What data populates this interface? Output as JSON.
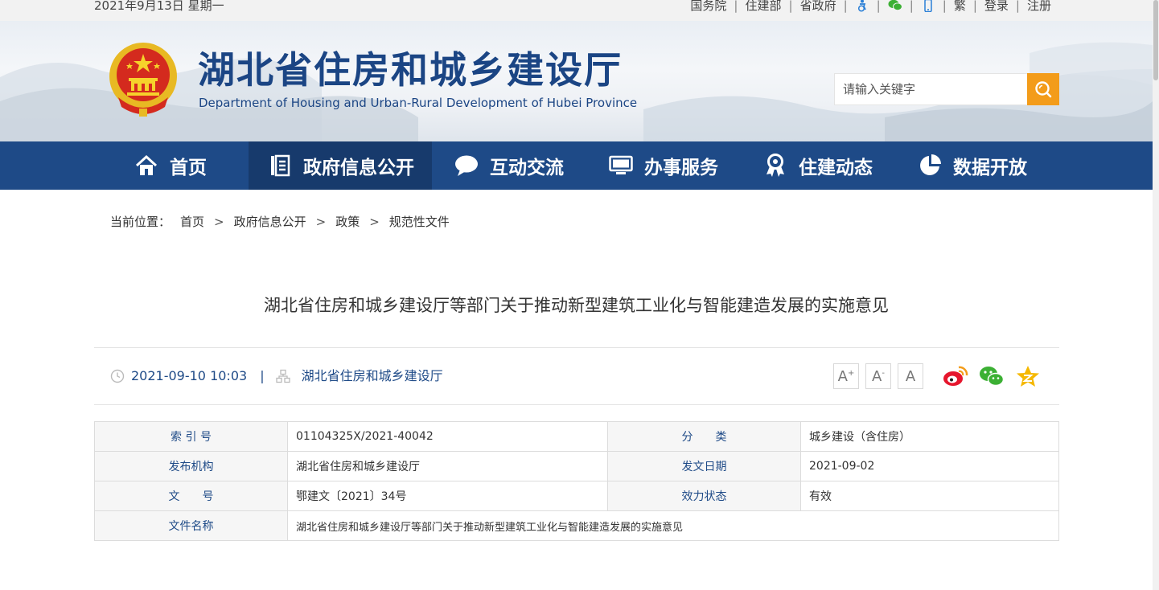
{
  "topbar": {
    "date": "2021年9月13日 星期一",
    "links": [
      {
        "label": "国务院"
      },
      {
        "label": "住建部"
      },
      {
        "label": "省政府"
      },
      {
        "icon": "accessibility-icon"
      },
      {
        "icon": "wechat-icon"
      },
      {
        "icon": "mobile-icon"
      },
      {
        "label": "繁"
      },
      {
        "label": "登录"
      },
      {
        "label": "注册"
      }
    ]
  },
  "header": {
    "title_cn": "湖北省住房和城乡建设厅",
    "title_en": "Department of Housing and Urban-Rural Development of Hubei Province",
    "search_placeholder": "请输入关键字"
  },
  "nav": [
    {
      "label": "首页",
      "icon": "home-icon"
    },
    {
      "label": "政府信息公开",
      "icon": "document-list-icon",
      "active": true
    },
    {
      "label": "互动交流",
      "icon": "chat-bubble-icon"
    },
    {
      "label": "办事服务",
      "icon": "monitor-icon"
    },
    {
      "label": "住建动态",
      "icon": "award-icon"
    },
    {
      "label": "数据开放",
      "icon": "pie-chart-icon"
    }
  ],
  "breadcrumb": {
    "prefix": "当前位置：",
    "items": [
      "首页",
      "政府信息公开",
      "政策",
      "规范性文件"
    ],
    "separator": ">"
  },
  "article": {
    "title": "湖北省住房和城乡建设厅等部门关于推动新型建筑工业化与智能建造发展的实施意见",
    "datetime": "2021-09-10 10:03",
    "meta_separator": "|",
    "source": "湖北省住房和城乡建设厅",
    "font_buttons": [
      "A",
      "A",
      "A"
    ],
    "font_button_marks": [
      "+",
      "-"
    ]
  },
  "info": {
    "index_label": "索 引 号",
    "index_value": "01104325X/2021-40042",
    "category_label": "分　　类",
    "category_value": "城乡建设（含住房）",
    "publisher_label": "发布机构",
    "publisher_value": "湖北省住房和城乡建设厅",
    "date_label": "发文日期",
    "date_value": "2021-09-02",
    "docno_label": "文　　号",
    "docno_value": "鄂建文〔2021〕34号",
    "status_label": "效力状态",
    "status_value": "有效",
    "name_label": "文件名称",
    "name_value": "湖北省住房和城乡建设厅等部门关于推动新型建筑工业化与智能建造发展的实施意见"
  },
  "colors": {
    "primary": "#1e4a87",
    "nav_active": "#173a6c",
    "search_button": "#f39c1a",
    "weibo": "#e6162d",
    "wechat": "#3cb034",
    "qzone": "#f5b800"
  }
}
